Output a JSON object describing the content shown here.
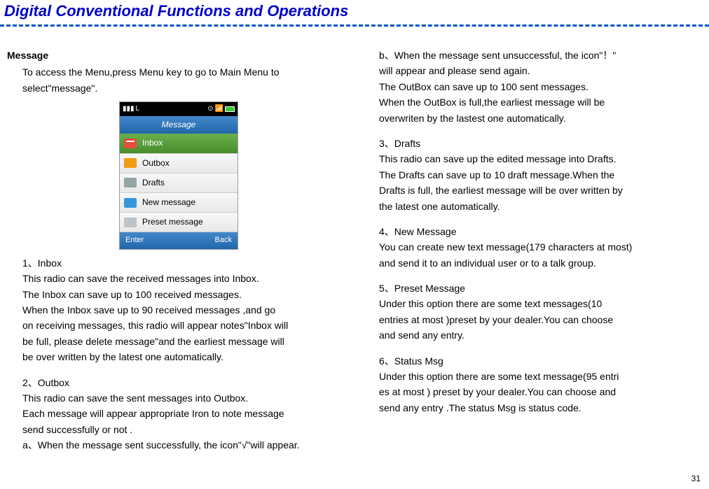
{
  "header": "Digital Conventional Functions and Operations",
  "leftCol": {
    "msgTitle": "Message",
    "msgIntro1": "To access the Menu,press Menu key to go to Main Menu to",
    "msgIntro2": "select\"message\".",
    "phone": {
      "statusL": "L",
      "title": "Message",
      "items": {
        "inbox": "Inbox",
        "outbox": "Outbox",
        "drafts": "Drafts",
        "newmsg": "New message",
        "preset": "Preset message"
      },
      "enter": "Enter",
      "back": "Back"
    },
    "s1": {
      "h": "1、Inbox",
      "p1": "This radio can save the received messages into Inbox.",
      "p2": "The Inbox can save up to 100 received messages.",
      "p3": "When the Inbox  save up to 90 received messages ,and go",
      "p4": "on receiving messages, this radio will appear notes\"Inbox will",
      "p5": "be full, please delete message\"and the earliest message will",
      "p6": "be over written by the latest one automatically."
    },
    "s2": {
      "h": "2、Outbox",
      "p1": "This radio can save the sent messages into Outbox.",
      "p2": "Each message will appear appropriate Iron to note message",
      "p3": "send successfully or not .",
      "p4": "a、When the message sent successfully, the icon\"√\"will appear."
    }
  },
  "rightCol": {
    "b1": "b、When the message sent unsuccessful, the icon\"！\"",
    "b2": "will appear and please send again.",
    "b3": "The OutBox can save up to 100 sent messages.",
    "b4": "When the OutBox is full,the earliest message will be",
    "b5": "overwriten by the lastest one automatically.",
    "s3": {
      "h": "3、Drafts",
      "p1": "This radio can save up the edited message into Drafts.",
      "p2": "The Drafts can save up to 10 draft message.When the",
      "p3": "Drafts is full, the earliest message will be over written by",
      "p4": "the latest one automatically."
    },
    "s4": {
      "h": "4、New Message",
      "p1": "You can create new text message(179 characters at most)",
      "p2": "and send it to an individual user or to a talk group."
    },
    "s5": {
      "h": "5、Preset  Message",
      "p1": "Under this option there are some text messages(10",
      "p2": "entries at most )preset by your dealer.You can choose",
      "p3": "and send any entry."
    },
    "s6": {
      "h": "6、Status Msg",
      "p1": "Under this option there are some text message(95 entri",
      "p2": "es at most ) preset by your dealer.You can choose and",
      "p3": "send any entry .The status Msg is status code."
    }
  },
  "pageNum": "31"
}
